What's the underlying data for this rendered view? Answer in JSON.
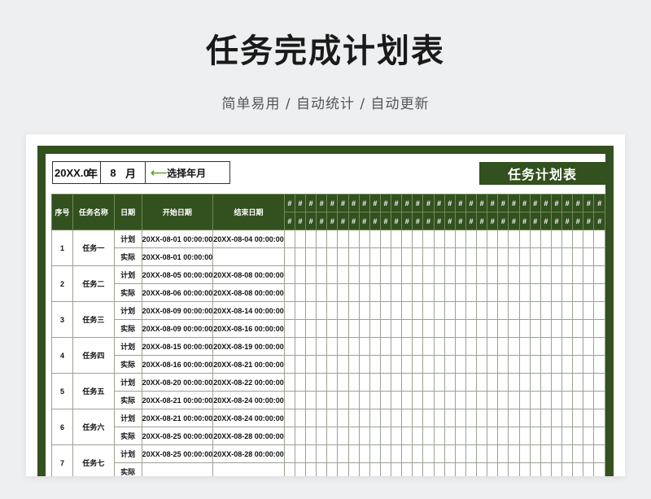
{
  "hero": {
    "title": "任务完成计划表",
    "subtitle": "简单易用 / 自动统计 / 自动更新"
  },
  "colors": {
    "header_green": "#33501f",
    "arrow_green": "#5fa82e"
  },
  "selector": {
    "year": "20XX.0",
    "year_unit": "年",
    "month": "8",
    "month_unit": "月",
    "arrow_icon": "arrow-left-icon",
    "hint": "选择年月"
  },
  "plan_title": "任务计划表",
  "table": {
    "headers": {
      "seq": "序号",
      "name": "任务名称",
      "date": "日期",
      "start": "开始日期",
      "end": "结束日期",
      "day_placeholder": "#"
    },
    "day_columns": 30,
    "tasks": [
      {
        "seq": "1",
        "name": "任务一",
        "rows": [
          {
            "type": "计划",
            "start": "20XX-08-01 00:00:00",
            "end": "20XX-08-04 00:00:00"
          },
          {
            "type": "实际",
            "start": "20XX-08-01 00:00:00",
            "end": ""
          }
        ]
      },
      {
        "seq": "2",
        "name": "任务二",
        "rows": [
          {
            "type": "计划",
            "start": "20XX-08-05 00:00:00",
            "end": "20XX-08-08 00:00:00"
          },
          {
            "type": "实际",
            "start": "20XX-08-06 00:00:00",
            "end": "20XX-08-08 00:00:00"
          }
        ]
      },
      {
        "seq": "3",
        "name": "任务三",
        "rows": [
          {
            "type": "计划",
            "start": "20XX-08-09 00:00:00",
            "end": "20XX-08-14 00:00:00"
          },
          {
            "type": "实际",
            "start": "20XX-08-09 00:00:00",
            "end": "20XX-08-16 00:00:00"
          }
        ]
      },
      {
        "seq": "4",
        "name": "任务四",
        "rows": [
          {
            "type": "计划",
            "start": "20XX-08-15 00:00:00",
            "end": "20XX-08-19 00:00:00"
          },
          {
            "type": "实际",
            "start": "20XX-08-16 00:00:00",
            "end": "20XX-08-21 00:00:00"
          }
        ]
      },
      {
        "seq": "5",
        "name": "任务五",
        "rows": [
          {
            "type": "计划",
            "start": "20XX-08-20 00:00:00",
            "end": "20XX-08-22 00:00:00"
          },
          {
            "type": "实际",
            "start": "20XX-08-21 00:00:00",
            "end": "20XX-08-24 00:00:00"
          }
        ]
      },
      {
        "seq": "6",
        "name": "任务六",
        "rows": [
          {
            "type": "计划",
            "start": "20XX-08-21 00:00:00",
            "end": "20XX-08-24 00:00:00"
          },
          {
            "type": "实际",
            "start": "20XX-08-25 00:00:00",
            "end": "20XX-08-28 00:00:00"
          }
        ]
      },
      {
        "seq": "7",
        "name": "任务七",
        "rows": [
          {
            "type": "计划",
            "start": "20XX-08-25 00:00:00",
            "end": "20XX-08-28 00:00:00"
          },
          {
            "type": "实际",
            "start": "",
            "end": ""
          }
        ]
      }
    ]
  }
}
